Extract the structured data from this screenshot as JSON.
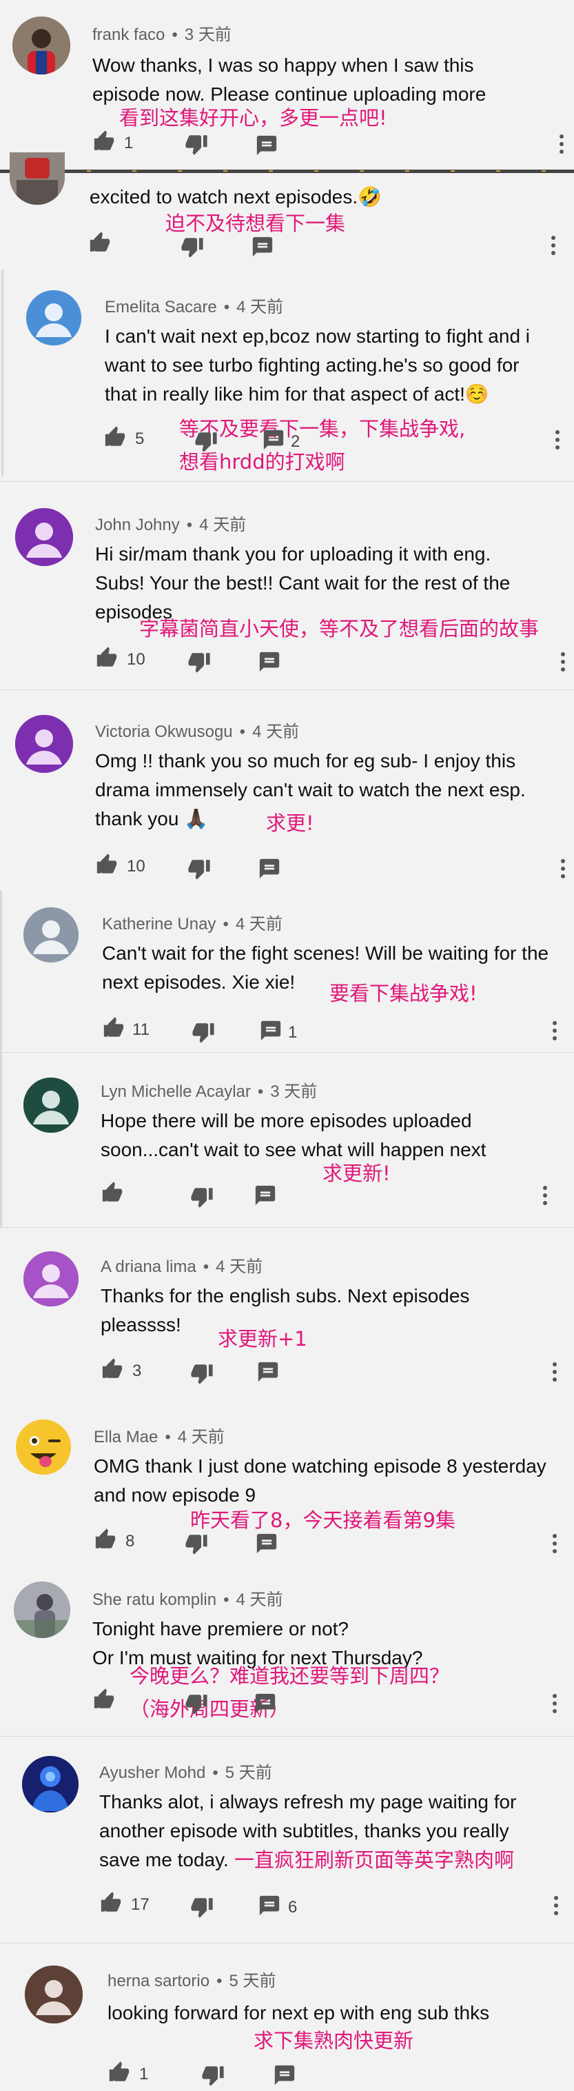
{
  "colors": {
    "annotation": "#e0187a",
    "background": "#f2f2f2",
    "meta_text": "#606060"
  },
  "icons": [
    "like-icon",
    "dislike-icon",
    "reply-icon",
    "more-icon"
  ],
  "comments": [
    {
      "author": "frank faco",
      "time": "3 天前",
      "text": "Wow thanks, I was so happy when I saw this episode now. Please continue uploading more",
      "annotation": "看到这集好开心，多更一点吧!",
      "likes": "1",
      "replies": ""
    },
    {
      "author": "",
      "time": "",
      "text": "excited to watch next episodes.🤣",
      "annotation": "迫不及待想看下一集",
      "likes": "",
      "replies": ""
    },
    {
      "author": "Emelita Sacare",
      "time": "4 天前",
      "text": "I can't wait next ep,bcoz now starting to fight and i want to see turbo fighting acting.he's so good for that in really like him for that aspect of act!☺️",
      "annotation": "等不及要看下一集，下集战争戏,",
      "annotation2": "想看hrdd的打戏啊",
      "likes": "5",
      "replies": "2"
    },
    {
      "author": "John Johny",
      "time": "4 天前",
      "text": "Hi sir/mam thank you for uploading it with eng. Subs! Your the best!! Cant wait for the rest of the episodes",
      "annotation": "字幕菌简直小天使，等不及了想看后面的故事",
      "likes": "10",
      "replies": ""
    },
    {
      "author": "Victoria Okwusogu",
      "time": "4 天前",
      "text": "Omg !! thank you so much for eg sub- I enjoy this drama immensely can't wait to watch the next esp. thank you 🙏🏿",
      "annotation": "求更!",
      "likes": "10",
      "replies": ""
    },
    {
      "author": "Katherine Unay",
      "time": "4 天前",
      "text": "Can't wait for the fight scenes! Will be waiting for the next episodes. Xie xie!",
      "annotation": "要看下集战争戏!",
      "likes": "11",
      "replies": "1"
    },
    {
      "author": "Lyn Michelle Acaylar",
      "time": "3 天前",
      "text": "Hope there will be more episodes uploaded soon...can't wait to see what will happen next",
      "annotation": "求更新!",
      "likes": "",
      "replies": ""
    },
    {
      "author": "A driana lima",
      "time": "4 天前",
      "text": "Thanks for the english subs. Next episodes pleassss!",
      "annotation": "求更新+1",
      "likes": "3",
      "replies": ""
    },
    {
      "author": "Ella Mae",
      "time": "4 天前",
      "text": "OMG thank I just done watching episode 8 yesterday and now episode 9",
      "annotation": "昨天看了8，今天接着看第9集",
      "likes": "8",
      "replies": ""
    },
    {
      "author": "She ratu komplin",
      "time": "4 天前",
      "text": "Tonight have premiere or not?\nOr I'm must waiting for next Thursday?",
      "annotation": "今晚更么？难道我还要等到下周四？",
      "annotation2": "（海外周四更新）",
      "likes": "",
      "replies": ""
    },
    {
      "author": "Ayusher Mohd",
      "time": "5 天前",
      "text": "Thanks alot, i always refresh my page waiting for another episode with subtitles, thanks you really save me today.",
      "annotation": "一直疯狂刷新页面等英字熟肉啊",
      "likes": "17",
      "replies": "6"
    },
    {
      "author": "herna sartorio",
      "time": "5 天前",
      "text": "looking forward for next ep with eng sub thks",
      "annotation": "求下集熟肉快更新",
      "likes": "1",
      "replies": ""
    }
  ]
}
